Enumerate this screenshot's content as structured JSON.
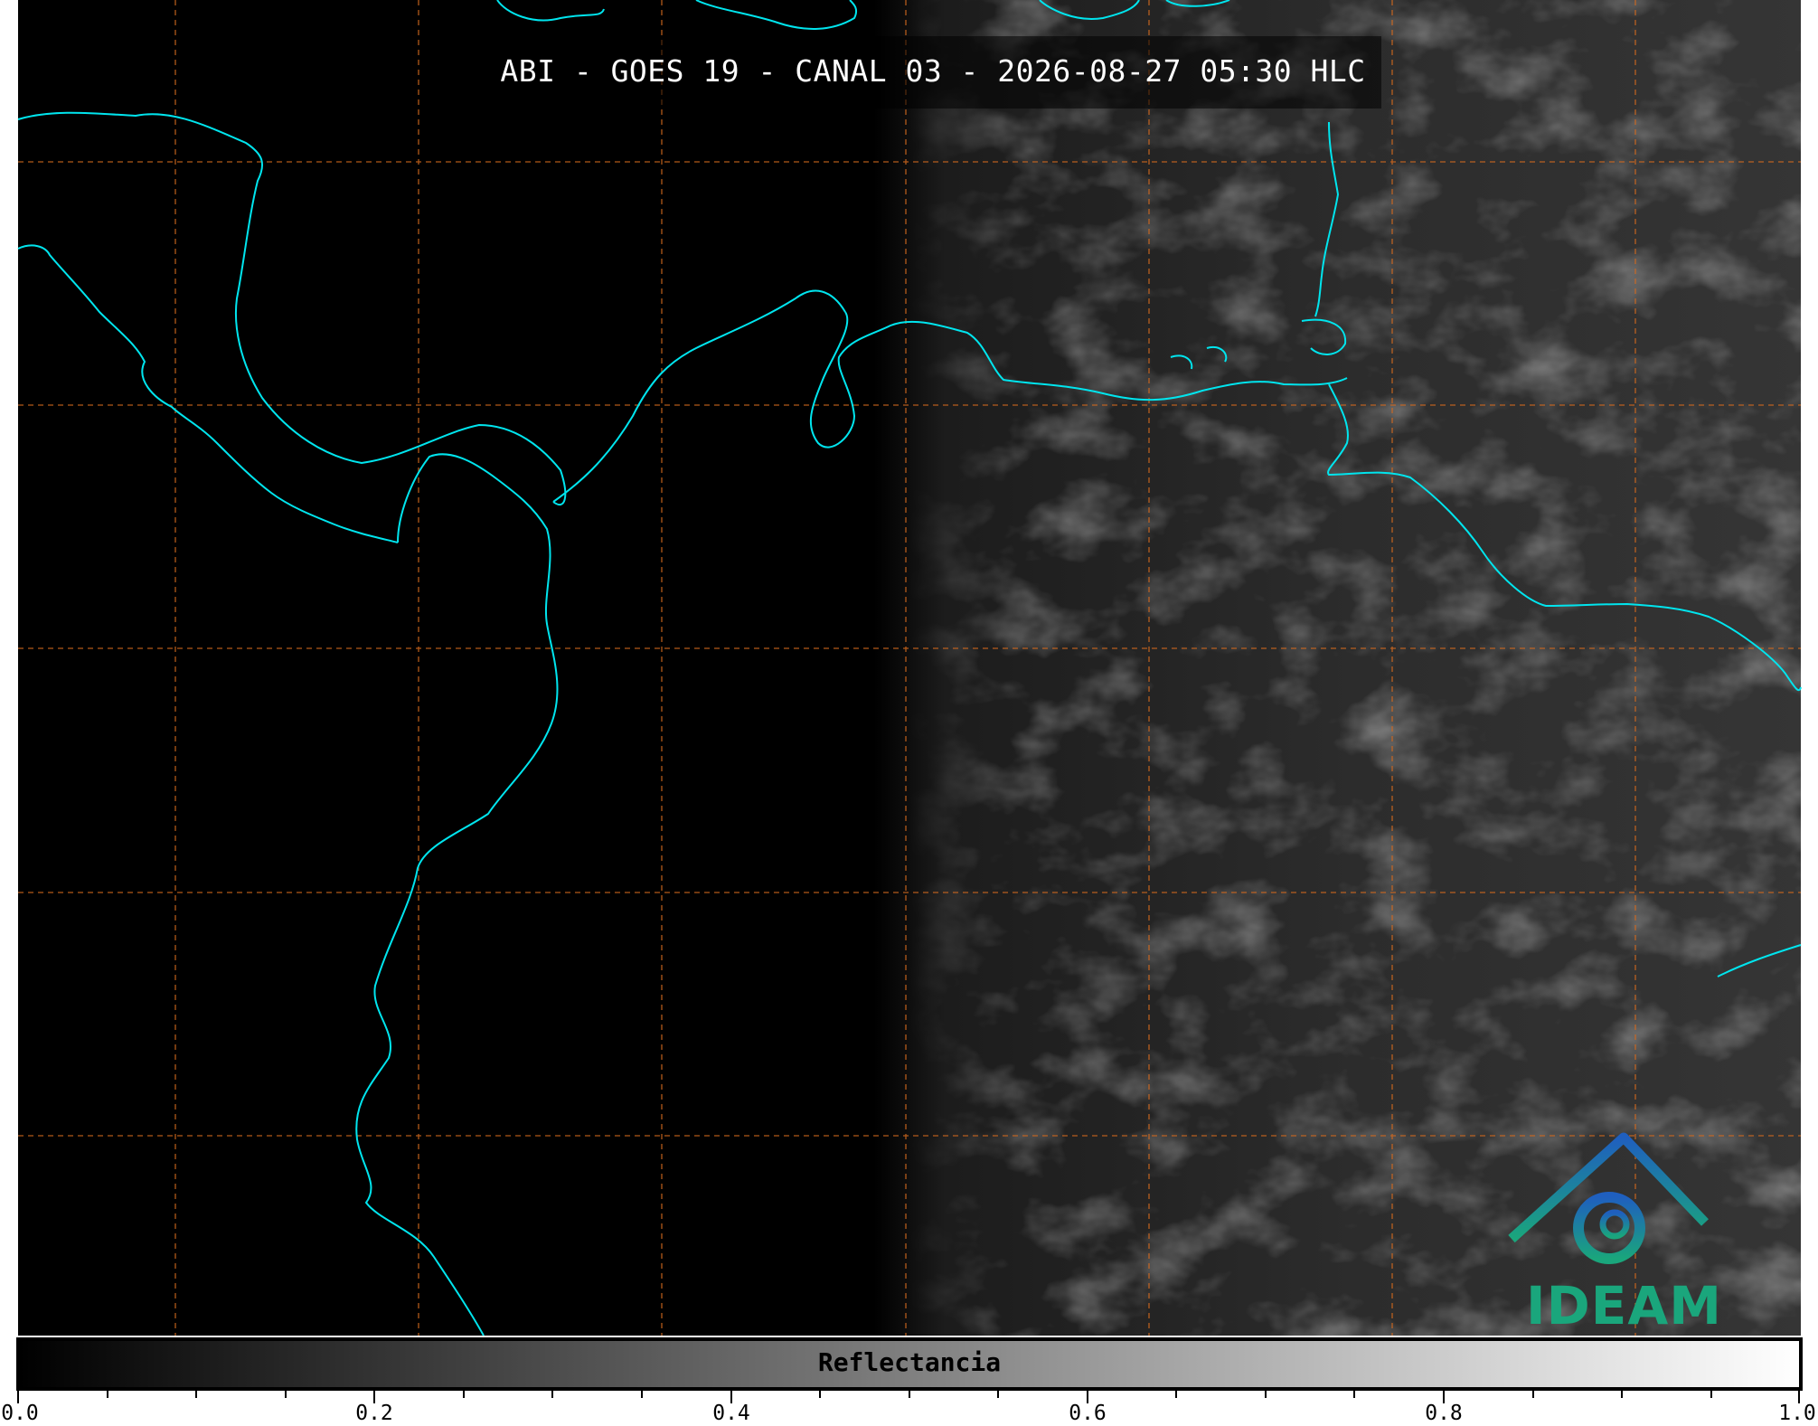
{
  "title": "ABI - GOES 19 - CANAL 03 - 2026-08-27 05:30 HLC",
  "colorbar": {
    "label": "Reflectancia",
    "ticks": [
      "0.0",
      "0.2",
      "0.4",
      "0.6",
      "0.8",
      "1.0"
    ],
    "min": 0.0,
    "max": 1.0,
    "gradient_start": "#000000",
    "gradient_end": "#ffffff"
  },
  "logo": {
    "text": "IDEAM",
    "icon": "ideam-mountain-swirl-logo",
    "colors": [
      "#1f5fbf",
      "#1aa67c"
    ]
  },
  "colors": {
    "coastline": "#00e5ee",
    "gridlines": "#d2691e",
    "night_side": "#000000",
    "day_side": "#303030"
  }
}
